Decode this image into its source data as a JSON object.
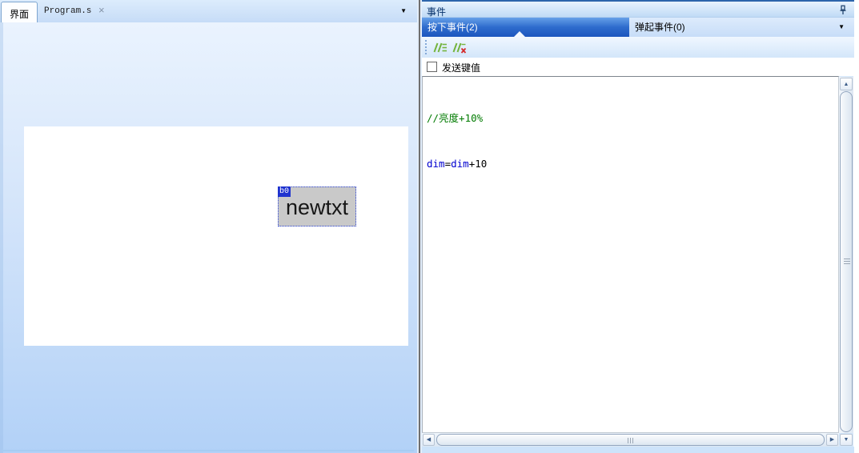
{
  "left_panel": {
    "tab_interface": "界面",
    "tab_program": "Program.s",
    "close_icon": "×",
    "dropdown_icon": "▼",
    "widget": {
      "badge": "b0",
      "label": "newtxt"
    }
  },
  "right_panel": {
    "title": "事件",
    "tab_press": "按下事件(2)",
    "tab_release": "弹起事件(0)",
    "dropdown_icon": "▼",
    "send_key_checkbox": {
      "label": "发送键值",
      "checked": false
    },
    "code": {
      "comment_line": "//亮度+10%",
      "statement": [
        {
          "text": "dim",
          "type": "identifier"
        },
        {
          "text": "=",
          "type": "operator"
        },
        {
          "text": "dim",
          "type": "identifier"
        },
        {
          "text": "+10",
          "type": "number"
        }
      ]
    },
    "scrollbar_icons": {
      "up": "▲",
      "down": "▼",
      "left": "◀",
      "right": "▶"
    }
  },
  "icons": {
    "pin": "pin-icon",
    "comment_add": "comment-lines-icon",
    "comment_remove": "comment-delete-icon"
  },
  "colors": {
    "selected_tab_top": "#66a0e8",
    "selected_tab_bottom": "#1c55be",
    "comment_green": "#007b00",
    "identifier_blue": "#0000cf",
    "widget_badge_blue": "#1f33cf",
    "widget_gray": "#c9c9c9",
    "icon_green": "#74b43e",
    "icon_red": "#d42a2a"
  }
}
